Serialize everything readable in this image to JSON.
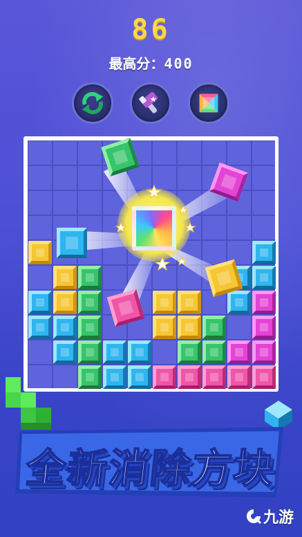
{
  "hud": {
    "score": "86",
    "best_score_label": "最高分：",
    "best_score_value": "400"
  },
  "powerups": [
    {
      "name": "refresh",
      "icon": "refresh-arrows-icon"
    },
    {
      "name": "hammer",
      "icon": "hammer-icon"
    },
    {
      "name": "rainbow-block",
      "icon": "rainbow-block-icon"
    }
  ],
  "board": {
    "rows": 10,
    "cols": 10,
    "filled": [
      {
        "r": 4,
        "c": 0,
        "color": "yellow"
      },
      {
        "r": 4,
        "c": 9,
        "color": "blue"
      },
      {
        "r": 5,
        "c": 1,
        "color": "yellow"
      },
      {
        "r": 5,
        "c": 2,
        "color": "green"
      },
      {
        "r": 5,
        "c": 8,
        "color": "blue"
      },
      {
        "r": 5,
        "c": 9,
        "color": "blue"
      },
      {
        "r": 6,
        "c": 0,
        "color": "blue"
      },
      {
        "r": 6,
        "c": 1,
        "color": "yellow"
      },
      {
        "r": 6,
        "c": 2,
        "color": "green"
      },
      {
        "r": 6,
        "c": 5,
        "color": "yellow"
      },
      {
        "r": 6,
        "c": 6,
        "color": "yellow"
      },
      {
        "r": 6,
        "c": 8,
        "color": "blue"
      },
      {
        "r": 6,
        "c": 9,
        "color": "magenta"
      },
      {
        "r": 7,
        "c": 0,
        "color": "blue"
      },
      {
        "r": 7,
        "c": 1,
        "color": "blue"
      },
      {
        "r": 7,
        "c": 2,
        "color": "green"
      },
      {
        "r": 7,
        "c": 5,
        "color": "yellow"
      },
      {
        "r": 7,
        "c": 6,
        "color": "yellow"
      },
      {
        "r": 7,
        "c": 7,
        "color": "green"
      },
      {
        "r": 7,
        "c": 9,
        "color": "magenta"
      },
      {
        "r": 8,
        "c": 1,
        "color": "blue"
      },
      {
        "r": 8,
        "c": 2,
        "color": "green"
      },
      {
        "r": 8,
        "c": 3,
        "color": "blue"
      },
      {
        "r": 8,
        "c": 4,
        "color": "blue"
      },
      {
        "r": 8,
        "c": 6,
        "color": "green"
      },
      {
        "r": 8,
        "c": 7,
        "color": "green"
      },
      {
        "r": 8,
        "c": 8,
        "color": "magenta"
      },
      {
        "r": 8,
        "c": 9,
        "color": "magenta"
      },
      {
        "r": 9,
        "c": 2,
        "color": "green"
      },
      {
        "r": 9,
        "c": 3,
        "color": "blue"
      },
      {
        "r": 9,
        "c": 4,
        "color": "blue"
      },
      {
        "r": 9,
        "c": 5,
        "color": "pink"
      },
      {
        "r": 9,
        "c": 6,
        "color": "pink"
      },
      {
        "r": 9,
        "c": 7,
        "color": "pink"
      },
      {
        "r": 9,
        "c": 8,
        "color": "pink"
      },
      {
        "r": 9,
        "c": 9,
        "color": "pink"
      }
    ]
  },
  "colors": {
    "score": "#ffd84a",
    "board_bg": "#5f64dd",
    "yellow": "#f6c633",
    "green": "#37c46b",
    "blue": "#2fb5ef",
    "pink": "#f055a8",
    "magenta": "#e344d6"
  },
  "banner": {
    "text": "全新消除方块"
  },
  "watermark": {
    "text": "九游",
    "icon": "jiuyou-logo-icon"
  }
}
